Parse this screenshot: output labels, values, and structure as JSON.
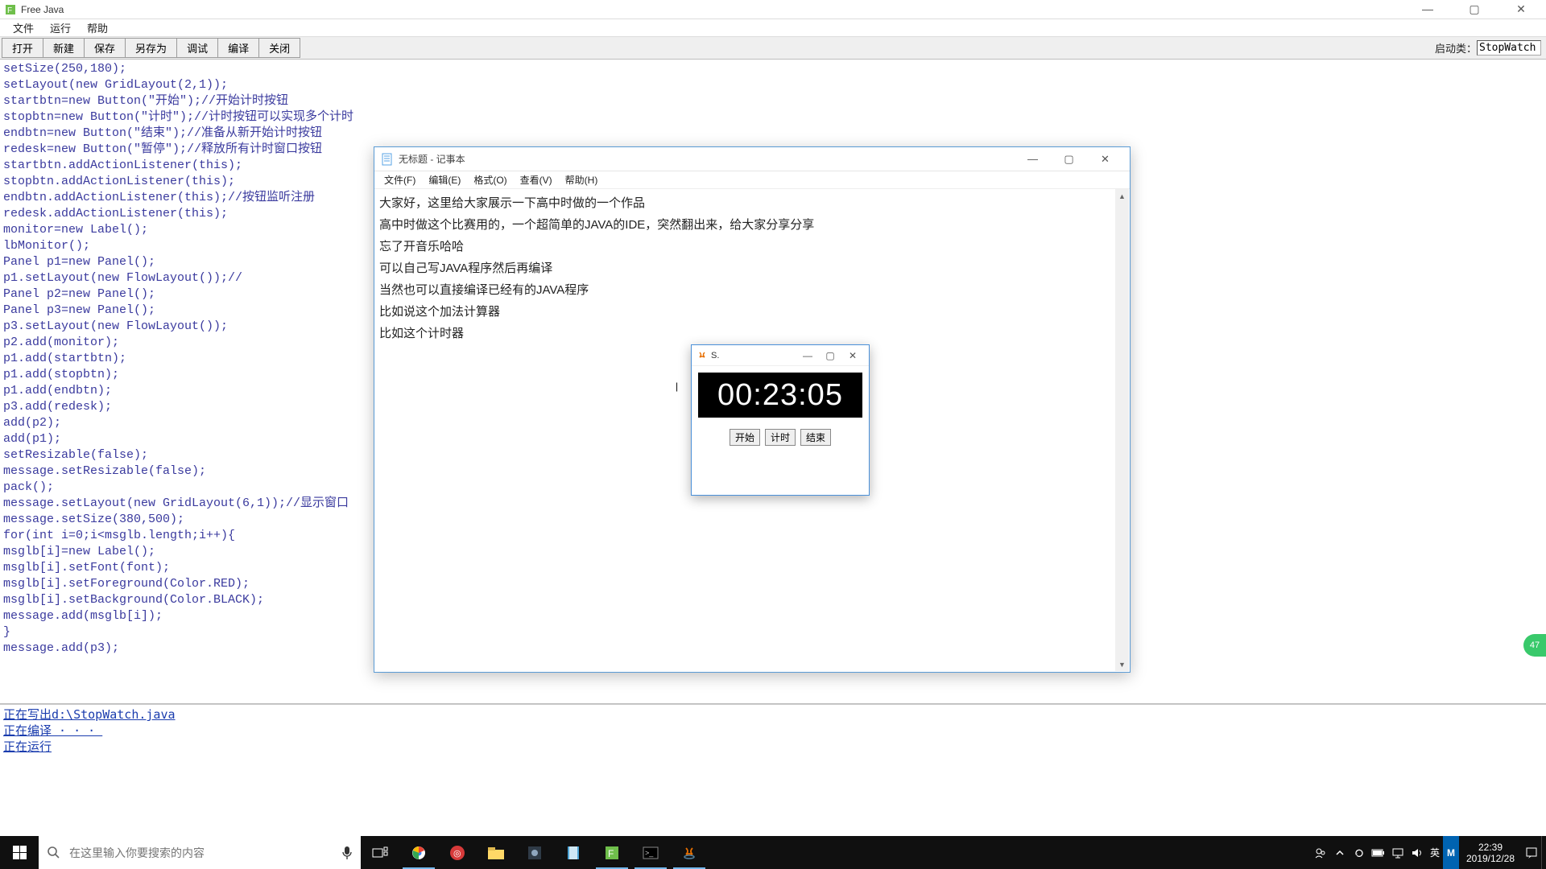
{
  "freejava": {
    "title": "Free Java",
    "menus": [
      "文件",
      "运行",
      "帮助"
    ],
    "toolbar": [
      "打开",
      "新建",
      "保存",
      "另存为",
      "调试",
      "编译",
      "关闭"
    ],
    "launch_label": "启动类：",
    "launch_value": "StopWatch",
    "code": "setSize(250,180);\nsetLayout(new GridLayout(2,1));\nstartbtn=new Button(\"开始\");//开始计时按钮\nstopbtn=new Button(\"计时\");//计时按钮可以实现多个计时\nendbtn=new Button(\"结束\");//准备从新开始计时按钮\nredesk=new Button(\"暂停\");//释放所有计时窗口按钮\nstartbtn.addActionListener(this);\nstopbtn.addActionListener(this);\nendbtn.addActionListener(this);//按钮监听注册\nredesk.addActionListener(this);\nmonitor=new Label();\nlbMonitor();\nPanel p1=new Panel();\np1.setLayout(new FlowLayout());//\nPanel p2=new Panel();\nPanel p3=new Panel();\np3.setLayout(new FlowLayout());\np2.add(monitor);\np1.add(startbtn);\np1.add(stopbtn);\np1.add(endbtn);\np3.add(redesk);\nadd(p2);\nadd(p1);\nsetResizable(false);\nmessage.setResizable(false);\npack();\nmessage.setLayout(new GridLayout(6,1));//显示窗口\nmessage.setSize(380,500);\nfor(int i=0;i<msglb.length;i++){\nmsglb[i]=new Label();\nmsglb[i].setFont(font);\nmsglb[i].setForeground(Color.RED);\nmsglb[i].setBackground(Color.BLACK);\nmessage.add(msglb[i]);\n}\nmessage.add(p3);",
    "console": "正在写出d:\\StopWatch.java\n正在编译 · · · \n正在运行"
  },
  "notepad": {
    "title": "无标题 - 记事本",
    "menus": [
      "文件(F)",
      "编辑(E)",
      "格式(O)",
      "查看(V)",
      "帮助(H)"
    ],
    "text": "大家好，这里给大家展示一下高中时做的一个作品\n高中时做这个比赛用的，一个超简单的JAVA的IDE，突然翻出来，给大家分享分享\n忘了开音乐哈哈\n可以自己写JAVA程序然后再编译\n当然也可以直接编译已经有的JAVA程序\n比如说这个加法计算器\n比如这个计时器"
  },
  "stopwatch": {
    "title": "S.",
    "time": "00:23:05",
    "buttons": [
      "开始",
      "计时",
      "结束"
    ]
  },
  "taskbar": {
    "search_placeholder": "在这里输入你要搜索的内容",
    "ime": "英",
    "ime2": "M",
    "time": "22:39",
    "date": "2019/12/28"
  },
  "badge": "47"
}
